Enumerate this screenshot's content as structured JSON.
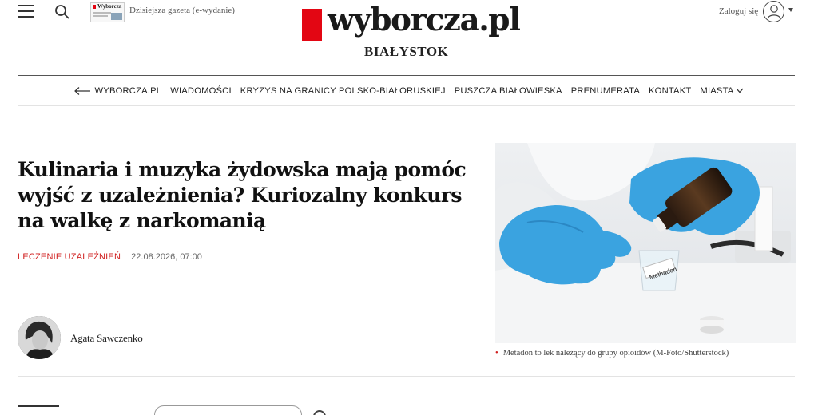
{
  "header": {
    "edition_link": "Dzisiejsza gazeta (e-wydanie)",
    "edition_thumb_title": "Wyborcza",
    "logo_text": "wyborcza.pl",
    "city": "BIAŁYSTOK",
    "login_label": "Zaloguj się",
    "icons": [
      "menu-icon",
      "search-icon",
      "user-icon",
      "caret-down-icon"
    ]
  },
  "nav": {
    "items": [
      "WYBORCZA.PL",
      "WIADOMOŚCI",
      "KRYZYS NA GRANICY POLSKO-BIAŁORUSKIEJ",
      "PUSZCZA BIAŁOWIESKA",
      "PRENUMERATA",
      "KONTAKT",
      "MIASTA"
    ]
  },
  "article": {
    "headline": "Kulinaria i muzyka żydowska mają pomóc wyjść z uzależnienia? Kuriozalny konkurs na walkę z narkomanią",
    "tag": "LECZENIE UZALEŻNIEŃ",
    "date": "22.08.2026, 07:00",
    "author": "Agata Sawczenko",
    "photo_label": "Methadon",
    "caption": "Metadon to lek należący do grupy opioidów (M-Foto/Shutterstock)"
  },
  "colors": {
    "brand_red": "#e30613",
    "tag_red": "#d01e1e",
    "glove_blue": "#3aa3e0"
  }
}
